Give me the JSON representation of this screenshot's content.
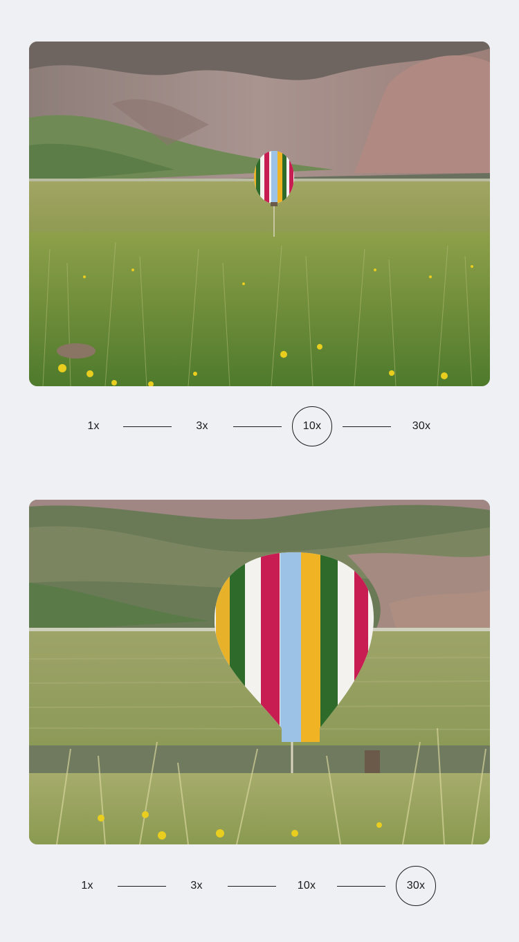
{
  "sections": [
    {
      "image": {
        "subject": "hot-air-balloon-meadow-wide",
        "zoom_shown": "10x"
      },
      "zoom_options": [
        "1x",
        "3x",
        "10x",
        "30x"
      ],
      "active_zoom": "10x"
    },
    {
      "image": {
        "subject": "hot-air-balloon-meadow-closeup",
        "zoom_shown": "30x"
      },
      "zoom_options": [
        "1x",
        "3x",
        "10x",
        "30x"
      ],
      "active_zoom": "30x"
    }
  ],
  "colors": {
    "background": "#eef0f3",
    "text": "#1a1a1a",
    "balloon_stripes": [
      "#e8b12a",
      "#2e6b2a",
      "#f4f2ee",
      "#c81d52",
      "#9cc3e6",
      "#f0b323"
    ]
  }
}
